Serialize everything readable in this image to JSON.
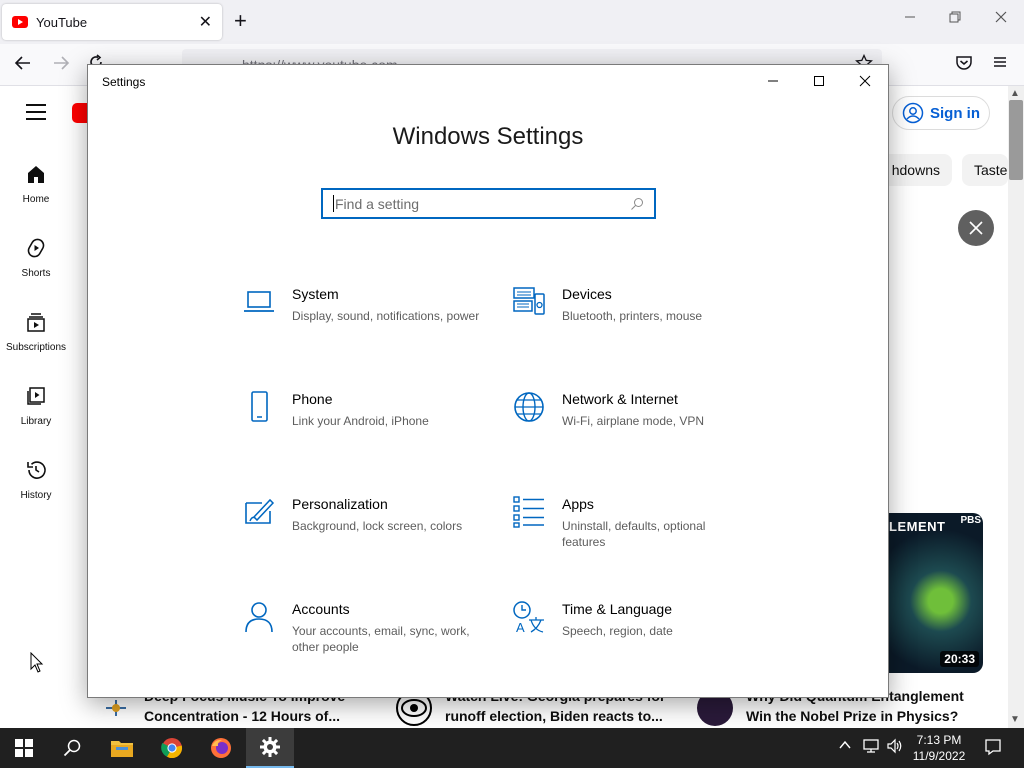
{
  "browser": {
    "tab_title": "YouTube",
    "tab_close": "✕",
    "new_tab": "+",
    "url": "https://www.youtube.com",
    "window_controls": {
      "minimize": "—",
      "maximize": "❐",
      "close": "✕"
    }
  },
  "youtube": {
    "sidebar": [
      {
        "label": "Home",
        "icon": "home-icon"
      },
      {
        "label": "Shorts",
        "icon": "shorts-icon"
      },
      {
        "label": "Subscriptions",
        "icon": "subscriptions-icon"
      },
      {
        "label": "Library",
        "icon": "library-icon"
      },
      {
        "label": "History",
        "icon": "history-icon"
      }
    ],
    "sign_in": "Sign in",
    "chips": [
      "hdowns",
      "Taste"
    ],
    "thumbnail": {
      "title": "LEMENT",
      "badge": "PBS",
      "duration": "20:33"
    },
    "videos": [
      {
        "title": "Deep Focus Music To Improve Concentration - 12 Hours of..."
      },
      {
        "title": "Watch Live: Georgia prepares for runoff election, Biden reacts to..."
      },
      {
        "title": "Why Did Quantum Entanglement Win the Nobel Prize in Physics?"
      }
    ]
  },
  "settings": {
    "window_title": "Settings",
    "heading": "Windows Settings",
    "search_placeholder": "Find a setting",
    "accent_color": "#0067c0",
    "categories": [
      {
        "name": "System",
        "desc": "Display, sound, notifications, power",
        "icon": "laptop-icon"
      },
      {
        "name": "Devices",
        "desc": "Bluetooth, printers, mouse",
        "icon": "devices-icon"
      },
      {
        "name": "Phone",
        "desc": "Link your Android, iPhone",
        "icon": "phone-icon"
      },
      {
        "name": "Network & Internet",
        "desc": "Wi-Fi, airplane mode, VPN",
        "icon": "globe-icon"
      },
      {
        "name": "Personalization",
        "desc": "Background, lock screen, colors",
        "icon": "personalization-icon"
      },
      {
        "name": "Apps",
        "desc": "Uninstall, defaults, optional features",
        "icon": "apps-icon"
      },
      {
        "name": "Accounts",
        "desc": "Your accounts, email, sync, work, other people",
        "icon": "person-icon"
      },
      {
        "name": "Time & Language",
        "desc": "Speech, region, date",
        "icon": "time-language-icon"
      }
    ]
  },
  "taskbar": {
    "time": "7:13 PM",
    "date": "11/9/2022"
  }
}
